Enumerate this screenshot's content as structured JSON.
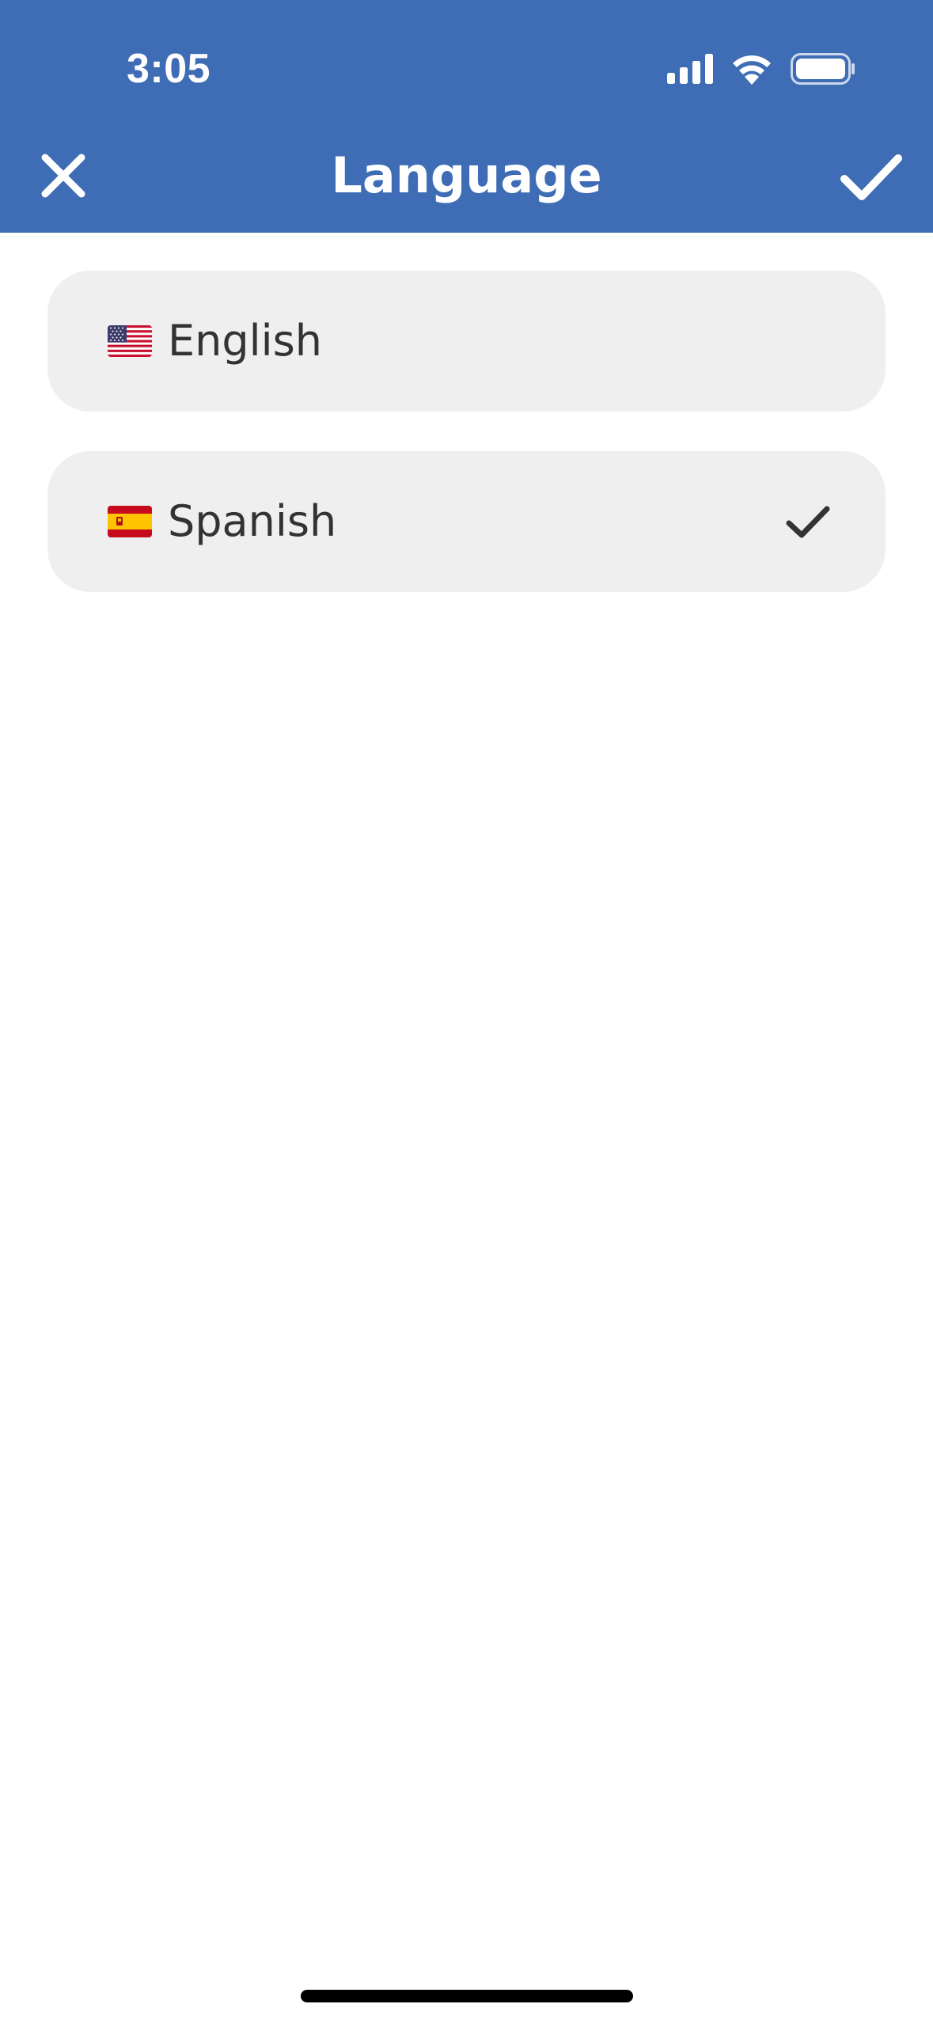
{
  "status_bar": {
    "time": "3:05",
    "icons": [
      "cellular-signal-icon",
      "wifi-icon",
      "battery-icon"
    ]
  },
  "header": {
    "title": "Language",
    "left_icon": "close-icon",
    "right_icon": "checkmark-icon",
    "background_color": "#3f6db5"
  },
  "languages": [
    {
      "label": "English",
      "flag": "us-flag-icon",
      "selected": false
    },
    {
      "label": "Spanish",
      "flag": "spain-flag-icon",
      "selected": true
    }
  ],
  "colors": {
    "accent": "#3f6db5",
    "item_background": "#efefef",
    "item_text": "#333333"
  }
}
